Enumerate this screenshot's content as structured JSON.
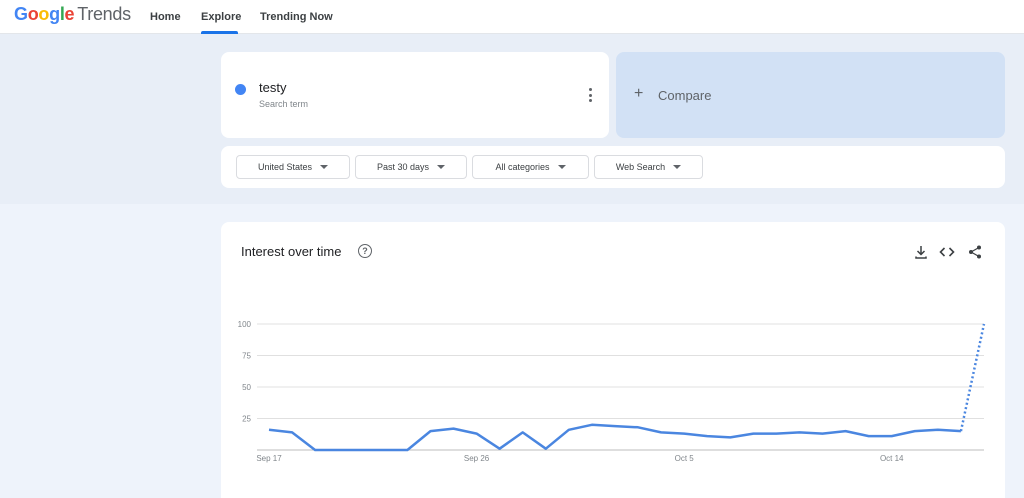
{
  "header": {
    "logo_google": "Google",
    "logo_trends": "Trends",
    "nav": [
      "Home",
      "Explore",
      "Trending Now"
    ]
  },
  "term": {
    "name": "testy",
    "subtitle": "Search term",
    "color": "#4285f4"
  },
  "compare": {
    "label": "Compare"
  },
  "filters": [
    "United States",
    "Past 30 days",
    "All categories",
    "Web Search"
  ],
  "chart_data": {
    "type": "line",
    "title": "Interest over time",
    "ylim": [
      0,
      100
    ],
    "yticks": [
      100,
      75,
      50,
      25
    ],
    "xtick_labels": [
      {
        "label": "Sep 17",
        "index": 0
      },
      {
        "label": "Sep 26",
        "index": 9
      },
      {
        "label": "Oct 5",
        "index": 18
      },
      {
        "label": "Oct 14",
        "index": 27
      }
    ],
    "series": [
      {
        "values": [
          16,
          14,
          0,
          0,
          0,
          0,
          0,
          15,
          17,
          13,
          1,
          14,
          1,
          16,
          20,
          19,
          18,
          14,
          13,
          11,
          10,
          13,
          13,
          14,
          13,
          15,
          11,
          11,
          15,
          16,
          15,
          100
        ],
        "partial_last_point": true,
        "color": "#4a86e0"
      }
    ]
  }
}
